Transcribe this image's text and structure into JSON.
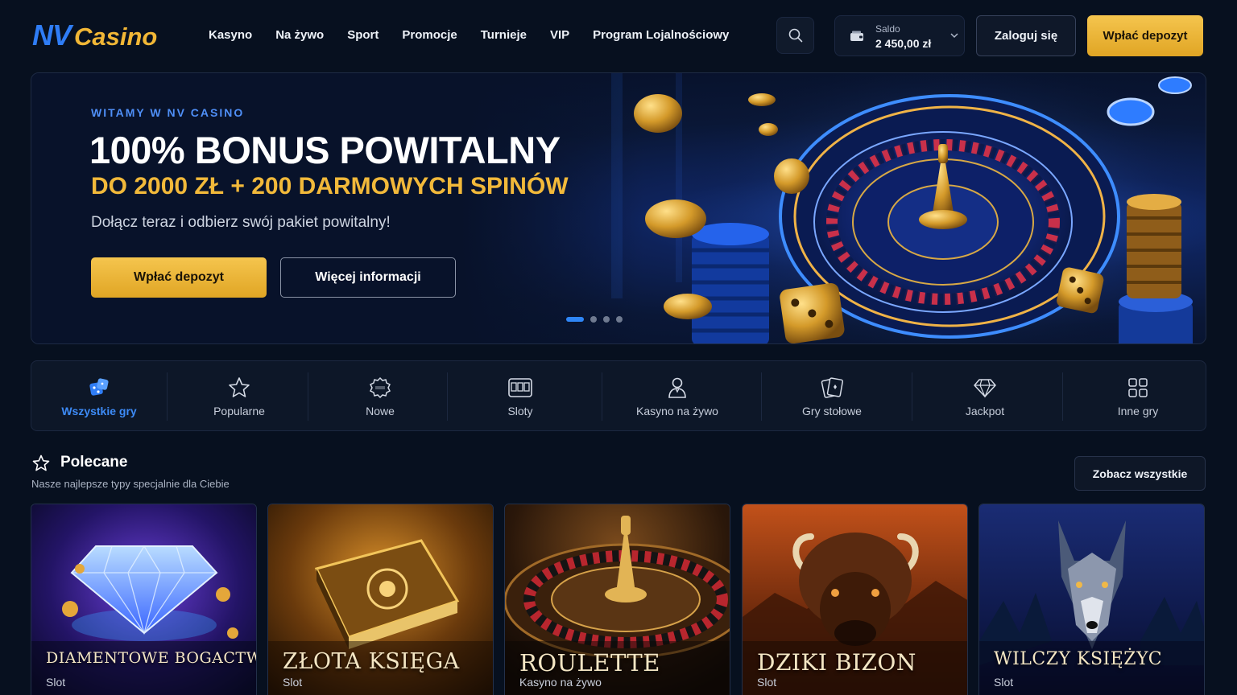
{
  "header": {
    "logo_nv": "NV",
    "logo_casino": "Casino",
    "nav": [
      "Kasyno",
      "Na żywo",
      "Sport",
      "Promocje",
      "Turnieje",
      "VIP",
      "Program Lojalnościowy"
    ],
    "search_icon": "search-icon",
    "balance_label": "Saldo",
    "balance_value": "2 450,00 zł",
    "login_label": "Zaloguj się",
    "deposit_label": "Wpłać depozyt"
  },
  "hero": {
    "eyebrow": "WITAMY W NV CASINO",
    "title": "100% BONUS POWITALNY",
    "subtitle": "DO 2000 ZŁ + 200 DARMOWYCH SPINÓW",
    "description": "Dołącz teraz i odbierz swój pakiet powitalny!",
    "primary_cta": "Wpłać depozyt",
    "secondary_cta": "Więcej informacji",
    "slides": 4,
    "active_slide": 1
  },
  "categories": [
    {
      "label": "Wszystkie gry",
      "icon": "dice-icon",
      "active": true
    },
    {
      "label": "Popularne",
      "icon": "star-icon",
      "active": false
    },
    {
      "label": "Nowe",
      "icon": "new-badge-icon",
      "active": false
    },
    {
      "label": "Sloty",
      "icon": "slot-machine-icon",
      "active": false
    },
    {
      "label": "Kasyno na żywo",
      "icon": "dealer-icon",
      "active": false
    },
    {
      "label": "Gry stołowe",
      "icon": "cards-icon",
      "active": false
    },
    {
      "label": "Jackpot",
      "icon": "diamond-icon",
      "active": false
    },
    {
      "label": "Inne gry",
      "icon": "grid-icon",
      "active": false
    }
  ],
  "featured": {
    "title": "Polecane",
    "subtitle": "Nasze najlepsze typy specjalnie dla Ciebie",
    "see_all": "Zobacz wszystkie",
    "games": [
      {
        "name": "DIAMENTOWE BOGACTWO",
        "type": "Slot"
      },
      {
        "name": "ZŁOTA KSIĘGA",
        "type": "Slot"
      },
      {
        "name": "ROULETTE",
        "type": "Kasyno na żywo"
      },
      {
        "name": "DZIKI BIZON",
        "type": "Slot"
      },
      {
        "name": "WILCZY KSIĘŻYC",
        "type": "Slot"
      }
    ]
  },
  "colors": {
    "accent_blue": "#2f7df6",
    "accent_gold": "#f2b93a",
    "background": "#07101f"
  }
}
